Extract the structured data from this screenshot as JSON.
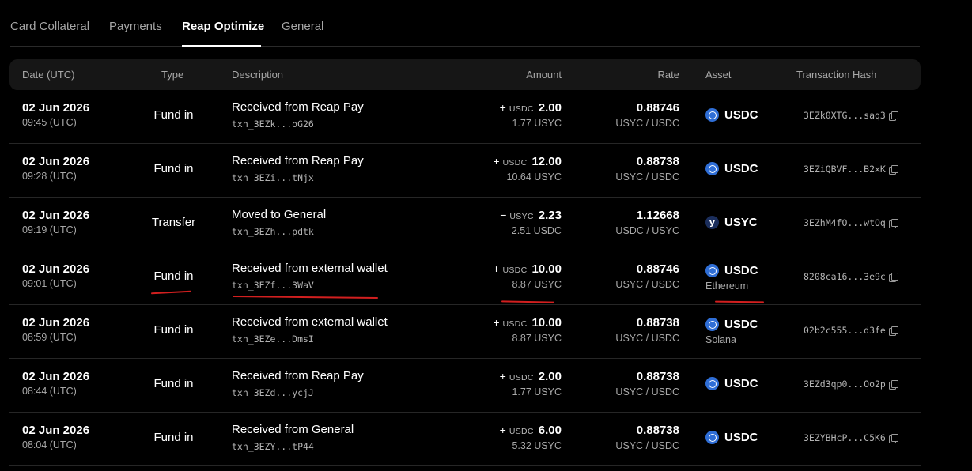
{
  "tabs": [
    {
      "label": "Card Collateral",
      "active": false
    },
    {
      "label": "Payments",
      "active": false
    },
    {
      "label": "Reap Optimize",
      "active": true
    },
    {
      "label": "General",
      "active": false
    }
  ],
  "columns": {
    "date": "Date (UTC)",
    "type": "Type",
    "description": "Description",
    "amount": "Amount",
    "rate": "Rate",
    "asset": "Asset",
    "hash": "Transaction Hash"
  },
  "rows": [
    {
      "date": "02 Jun 2026",
      "time": "09:45 (UTC)",
      "type": "Fund in",
      "description": "Received from Reap Pay",
      "txn": "txn_3EZk...oG26",
      "sign": "+",
      "currency": "USDC",
      "amount": "2.00",
      "amount_sub": "1.77 USYC",
      "rate": "0.88746",
      "rate_pair": "USYC / USDC",
      "asset": "USDC",
      "asset_icon": "usdc-icon",
      "chain": "",
      "hash": "3EZk0XTG...saq3"
    },
    {
      "date": "02 Jun 2026",
      "time": "09:28 (UTC)",
      "type": "Fund in",
      "description": "Received from Reap Pay",
      "txn": "txn_3EZi...tNjx",
      "sign": "+",
      "currency": "USDC",
      "amount": "12.00",
      "amount_sub": "10.64 USYC",
      "rate": "0.88738",
      "rate_pair": "USYC / USDC",
      "asset": "USDC",
      "asset_icon": "usdc-icon",
      "chain": "",
      "hash": "3EZiQBVF...B2xK"
    },
    {
      "date": "02 Jun 2026",
      "time": "09:19 (UTC)",
      "type": "Transfer",
      "description": "Moved to General",
      "txn": "txn_3EZh...pdtk",
      "sign": "−",
      "currency": "USYC",
      "amount": "2.23",
      "amount_sub": "2.51 USDC",
      "rate": "1.12668",
      "rate_pair": "USDC / USYC",
      "asset": "USYC",
      "asset_icon": "usyc-icon",
      "chain": "",
      "hash": "3EZhM4fO...wtOq"
    },
    {
      "date": "02 Jun 2026",
      "time": "09:01 (UTC)",
      "type": "Fund in",
      "description": "Received from external wallet",
      "txn": "txn_3EZf...3WaV",
      "sign": "+",
      "currency": "USDC",
      "amount": "10.00",
      "amount_sub": "8.87 USYC",
      "rate": "0.88746",
      "rate_pair": "USYC / USDC",
      "asset": "USDC",
      "asset_icon": "usdc-icon",
      "chain": "Ethereum",
      "hash": "8208ca16...3e9c"
    },
    {
      "date": "02 Jun 2026",
      "time": "08:59 (UTC)",
      "type": "Fund in",
      "description": "Received from external wallet",
      "txn": "txn_3EZe...DmsI",
      "sign": "+",
      "currency": "USDC",
      "amount": "10.00",
      "amount_sub": "8.87 USYC",
      "rate": "0.88738",
      "rate_pair": "USYC / USDC",
      "asset": "USDC",
      "asset_icon": "usdc-icon",
      "chain": "Solana",
      "hash": "02b2c555...d3fe"
    },
    {
      "date": "02 Jun 2026",
      "time": "08:44 (UTC)",
      "type": "Fund in",
      "description": "Received from Reap Pay",
      "txn": "txn_3EZd...ycjJ",
      "sign": "+",
      "currency": "USDC",
      "amount": "2.00",
      "amount_sub": "1.77 USYC",
      "rate": "0.88738",
      "rate_pair": "USYC / USDC",
      "asset": "USDC",
      "asset_icon": "usdc-icon",
      "chain": "",
      "hash": "3EZd3qp0...Oo2p"
    },
    {
      "date": "02 Jun 2026",
      "time": "08:04 (UTC)",
      "type": "Fund in",
      "description": "Received from General",
      "txn": "txn_3EZY...tP44",
      "sign": "+",
      "currency": "USDC",
      "amount": "6.00",
      "amount_sub": "5.32 USYC",
      "rate": "0.88738",
      "rate_pair": "USYC / USDC",
      "asset": "USDC",
      "asset_icon": "usdc-icon",
      "chain": "",
      "hash": "3EZYBHcP...C5K6"
    }
  ],
  "annotation_color": "#d21f1f"
}
